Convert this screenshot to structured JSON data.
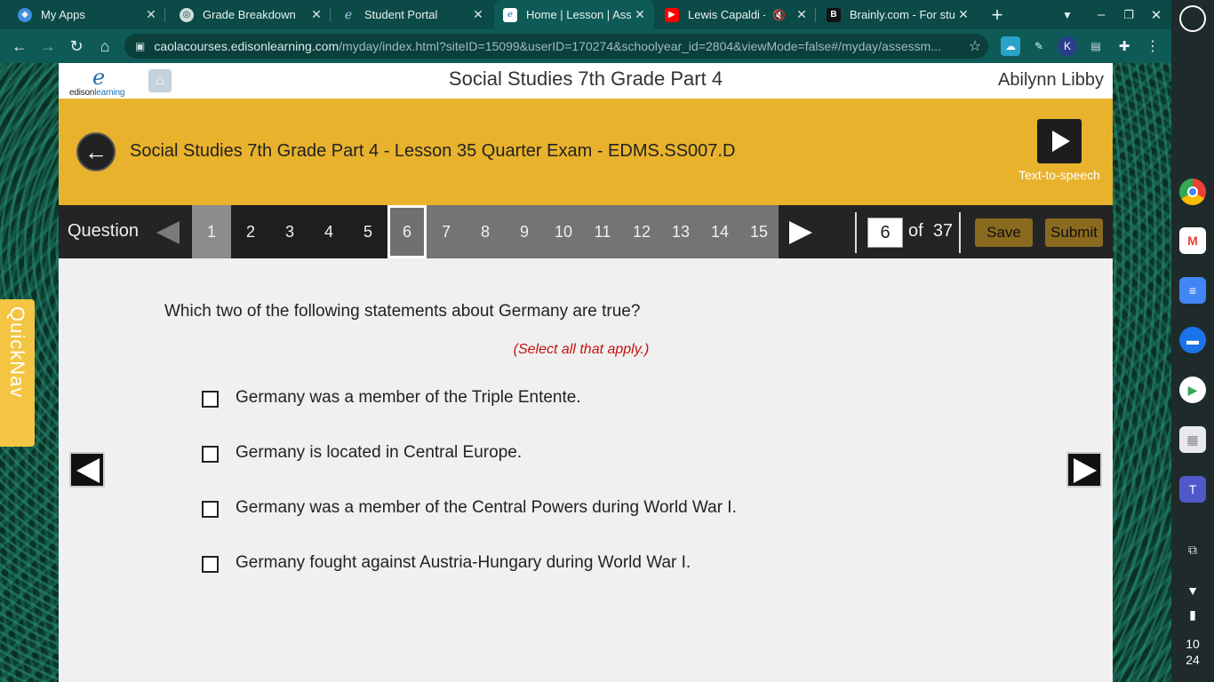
{
  "browser": {
    "tabs": [
      {
        "title": "My Apps",
        "favicon": "my-apps-icon",
        "color": "#3d8ee0"
      },
      {
        "title": "Grade Breakdown",
        "favicon": "globe-icon",
        "color": "#cfdcdb"
      },
      {
        "title": "Student Portal",
        "favicon": "edison-icon",
        "color": "#a9c9e8"
      },
      {
        "title": "Home | Lesson | Asse",
        "favicon": "edison-icon",
        "color": "#a9c9e8",
        "active": true
      },
      {
        "title": "Lewis Capaldi - H",
        "favicon": "youtube-icon",
        "color": "#ff0000"
      },
      {
        "title": "Brainly.com - For stud",
        "favicon": "brainly-icon",
        "color": "#111111"
      }
    ],
    "url_host": "caolacourses.edisonlearning.com",
    "url_path": "/myday/index.html?siteID=15099&userID=170274&schoolyear_id=2804&viewMode=false#/myday/assessm..."
  },
  "header": {
    "course_title": "Social Studies 7th Grade Part 4",
    "student_name": "Abilynn Libby",
    "logo_mark": "e",
    "logo_text_a": "edison",
    "logo_text_b": "learning"
  },
  "banner": {
    "lesson_title": "Social Studies 7th Grade Part 4 - Lesson 35 Quarter Exam - EDMS.SS007.D",
    "tts_label": "Text-to-speech",
    "color": "#e8b22d"
  },
  "question_nav": {
    "label": "Question",
    "numbers": [
      "1",
      "2",
      "3",
      "4",
      "5",
      "6",
      "7",
      "8",
      "9",
      "10",
      "11",
      "12",
      "13",
      "14",
      "15"
    ],
    "current": "6",
    "page_input": "6",
    "of_label": "of",
    "total": "37",
    "save_label": "Save",
    "submit_label": "Submit"
  },
  "question": {
    "text": "Which two of the following statements about Germany are true?",
    "hint": "(Select all that apply.)",
    "options": [
      "Germany was a member of the Triple Entente.",
      "Germany is located in Central Europe.",
      "Germany was a member of the Central Powers during World War I.",
      "Germany fought against Austria-Hungary during World War I."
    ]
  },
  "quicknav_label": "QuickNav",
  "shelf": {
    "apps": [
      "chrome-icon",
      "gmail-icon",
      "docs-icon",
      "files-icon",
      "play-store-icon",
      "app-launcher-icon",
      "teams-icon",
      "screen-capture-icon"
    ],
    "clock_hour": "10",
    "clock_min": "24"
  }
}
